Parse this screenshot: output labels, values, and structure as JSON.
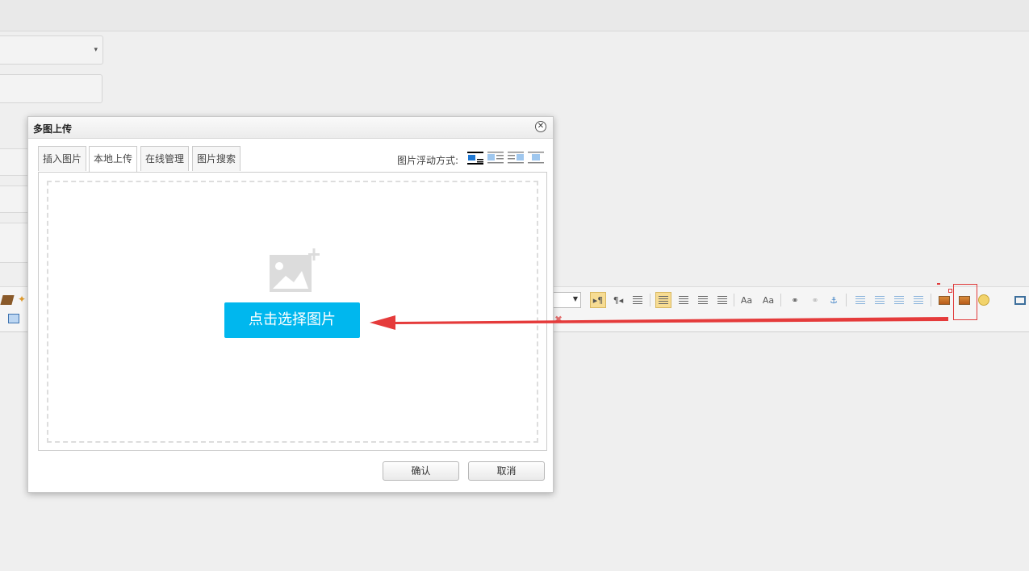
{
  "dialog": {
    "title": "多图上传",
    "tabs": [
      {
        "label": "插入图片",
        "active": false
      },
      {
        "label": "本地上传",
        "active": true
      },
      {
        "label": "在线管理",
        "active": false
      },
      {
        "label": "图片搜索",
        "active": false
      }
    ],
    "float_label": "图片浮动方式:",
    "float_options": [
      "none",
      "left",
      "right",
      "center"
    ],
    "float_selected": "none",
    "choose_button": "点击选择图片",
    "confirm_button": "确认",
    "cancel_button": "取消"
  },
  "background": {
    "select_caret": "▾"
  },
  "colors": {
    "accent": "#00b7ee",
    "arrow": "#e53b3b",
    "highlight_box": "#e03b3b",
    "active_toolbar": "#f7dc93"
  },
  "icons": [
    "close-icon",
    "image-placeholder-icon",
    "float-none-icon",
    "float-left-icon",
    "float-right-icon",
    "float-center-icon",
    "ltr-icon",
    "rtl-icon",
    "indent-icon",
    "justify-left-icon",
    "justify-center-icon",
    "justify-right-icon",
    "justify-full-icon",
    "font-case-icon",
    "link-icon",
    "unlink-icon",
    "anchor-icon",
    "simple-image-icon",
    "multi-image-icon",
    "emotion-icon",
    "preview-icon"
  ]
}
